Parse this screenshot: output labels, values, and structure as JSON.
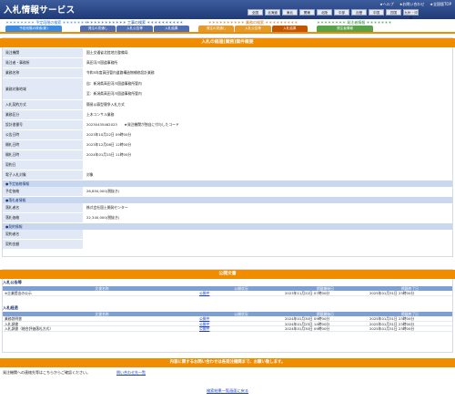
{
  "header": {
    "title": "入札情報サービス",
    "links": [
      "★ヘルプ",
      "★お問い合わせ",
      "★全国版TOP"
    ],
    "regions": [
      "全国",
      "北海道",
      "東北",
      "関東",
      "北陸",
      "中部",
      "近畿",
      "中国",
      "四国",
      "九州・沖縄"
    ]
  },
  "nav": {
    "groups": [
      {
        "title": "＊＊＊＊＊＊＊＊ 予定段階の検索 ＊＊＊＊＊＊＊",
        "title_color": "#2f7bd1",
        "tabs": [
          {
            "label": "予定段階の検索(新)",
            "color": "#3b8be0"
          }
        ]
      },
      {
        "title": "＊＊＊＊＊＊＊＊＊＊＊ 工事の検索 ＊＊＊＊＊＊＊＊＊＊",
        "title_color": "#1d4fa0",
        "tabs": [
          {
            "label": "発注の見通し",
            "color": "#4f6fb2"
          },
          {
            "label": "入札公告等",
            "color": "#4f6fb2"
          },
          {
            "label": "入札結果",
            "color": "#4f6fb2"
          }
        ]
      },
      {
        "title": "＊＊＊＊＊＊＊＊＊＊ 業務の検索 ＊＊＊＊＊＊＊＊＊",
        "title_color": "#d27000",
        "tabs": [
          {
            "label": "発注の見通し",
            "color": "#e39a2a"
          },
          {
            "label": "入札公告等",
            "color": "#e39a2a"
          },
          {
            "label": "入札結果",
            "color": "#c45500"
          }
        ]
      },
      {
        "title": "＊＊＊＊＊＊＊＊ 発注者情報 ＊＊＊＊＊＊＊",
        "title_color": "#2c8a2c",
        "tabs": [
          {
            "label": "発注者情報",
            "color": "#58a34a"
          }
        ]
      }
    ]
  },
  "detail": {
    "section_title": "入札の経過(業務)案件概要",
    "rows": [
      {
        "label": "発注機関",
        "value": "国土交通省北陸地方整備局"
      },
      {
        "label": "発注者・事務所",
        "value": "高田河川国道事務所"
      },
      {
        "label": "業務名称",
        "value": "令和5年度高田管内道路構造物補修設計業務"
      },
      {
        "label": "業務対象地域",
        "value": "自：新潟県高田河川国道事務所管内",
        "value2": "至：新潟県高田河川国道事務所管内"
      },
      {
        "label": "入札契約方式",
        "value": "簡易公募型競争入札方式"
      },
      {
        "label": "業務区分",
        "value": "土木コンサル業務"
      },
      {
        "label": "設計書番号",
        "value": "20230435462023　　★発注機関が独自に付与したコード"
      },
      {
        "label": "公告日時",
        "value": "2023年10月22日 09時00分"
      },
      {
        "label": "開札日時",
        "value": "2023年12月08日 12時00分"
      },
      {
        "label": "開札日時",
        "value": "2024年01月15日 11時00分"
      },
      {
        "label": "契約日",
        "value": ""
      },
      {
        "label": "電子入札対象",
        "value": "対象"
      }
    ],
    "subsection1": "●予定価格情報",
    "rows2": [
      {
        "label": "予定価格",
        "value": "26,850,000(税抜き)"
      }
    ],
    "subsection2": "●落札者情報",
    "rows3": [
      {
        "label": "落札者名",
        "value": "株式会社国土開発センター"
      },
      {
        "label": "落札価格",
        "value": "22,340,000(税抜き)"
      }
    ],
    "subsection3": "●契約情報",
    "rows4": [
      {
        "label": "契約者名",
        "value": ""
      },
      {
        "label": "契約金額",
        "value": ""
      }
    ]
  },
  "docs": {
    "section_title": "公開文書",
    "cat1": "入札公告等",
    "headers": [
      "文書名称",
      "公開状況",
      "掲載開始日",
      "掲載終了日"
    ],
    "rows1": [
      {
        "name": "※企業提出の公示",
        "status": "公開中",
        "start": "2023年11月22日 07時00分",
        "end": "2025年01月31日 23時00分"
      }
    ],
    "cat2": "入札経過",
    "rows2": [
      {
        "name": "業務説明書",
        "status": "公開中",
        "start": "2024年01月30日 09時00分",
        "end": "2025年01月31日 23時00分"
      },
      {
        "name": "入札調書",
        "status": "公開中",
        "start": "2024年01月25日 14時00分",
        "end": "2025年01月31日 23時00分"
      },
      {
        "name": "入札調書（総合評価落札方式）",
        "status": "公開中",
        "start": "2024年01月30日 09時00分",
        "end": "2025年01月31日 23時00分"
      }
    ]
  },
  "footer": {
    "contact_banner": "内容に関するお問い合わせは各発注機関まで、お願い致します。",
    "contact_text": "発注機関への連絡先等はこちらからご確認ください。",
    "contact_link": "問い合わせ先一覧",
    "back_link": "検索結果一覧画面に戻る"
  }
}
